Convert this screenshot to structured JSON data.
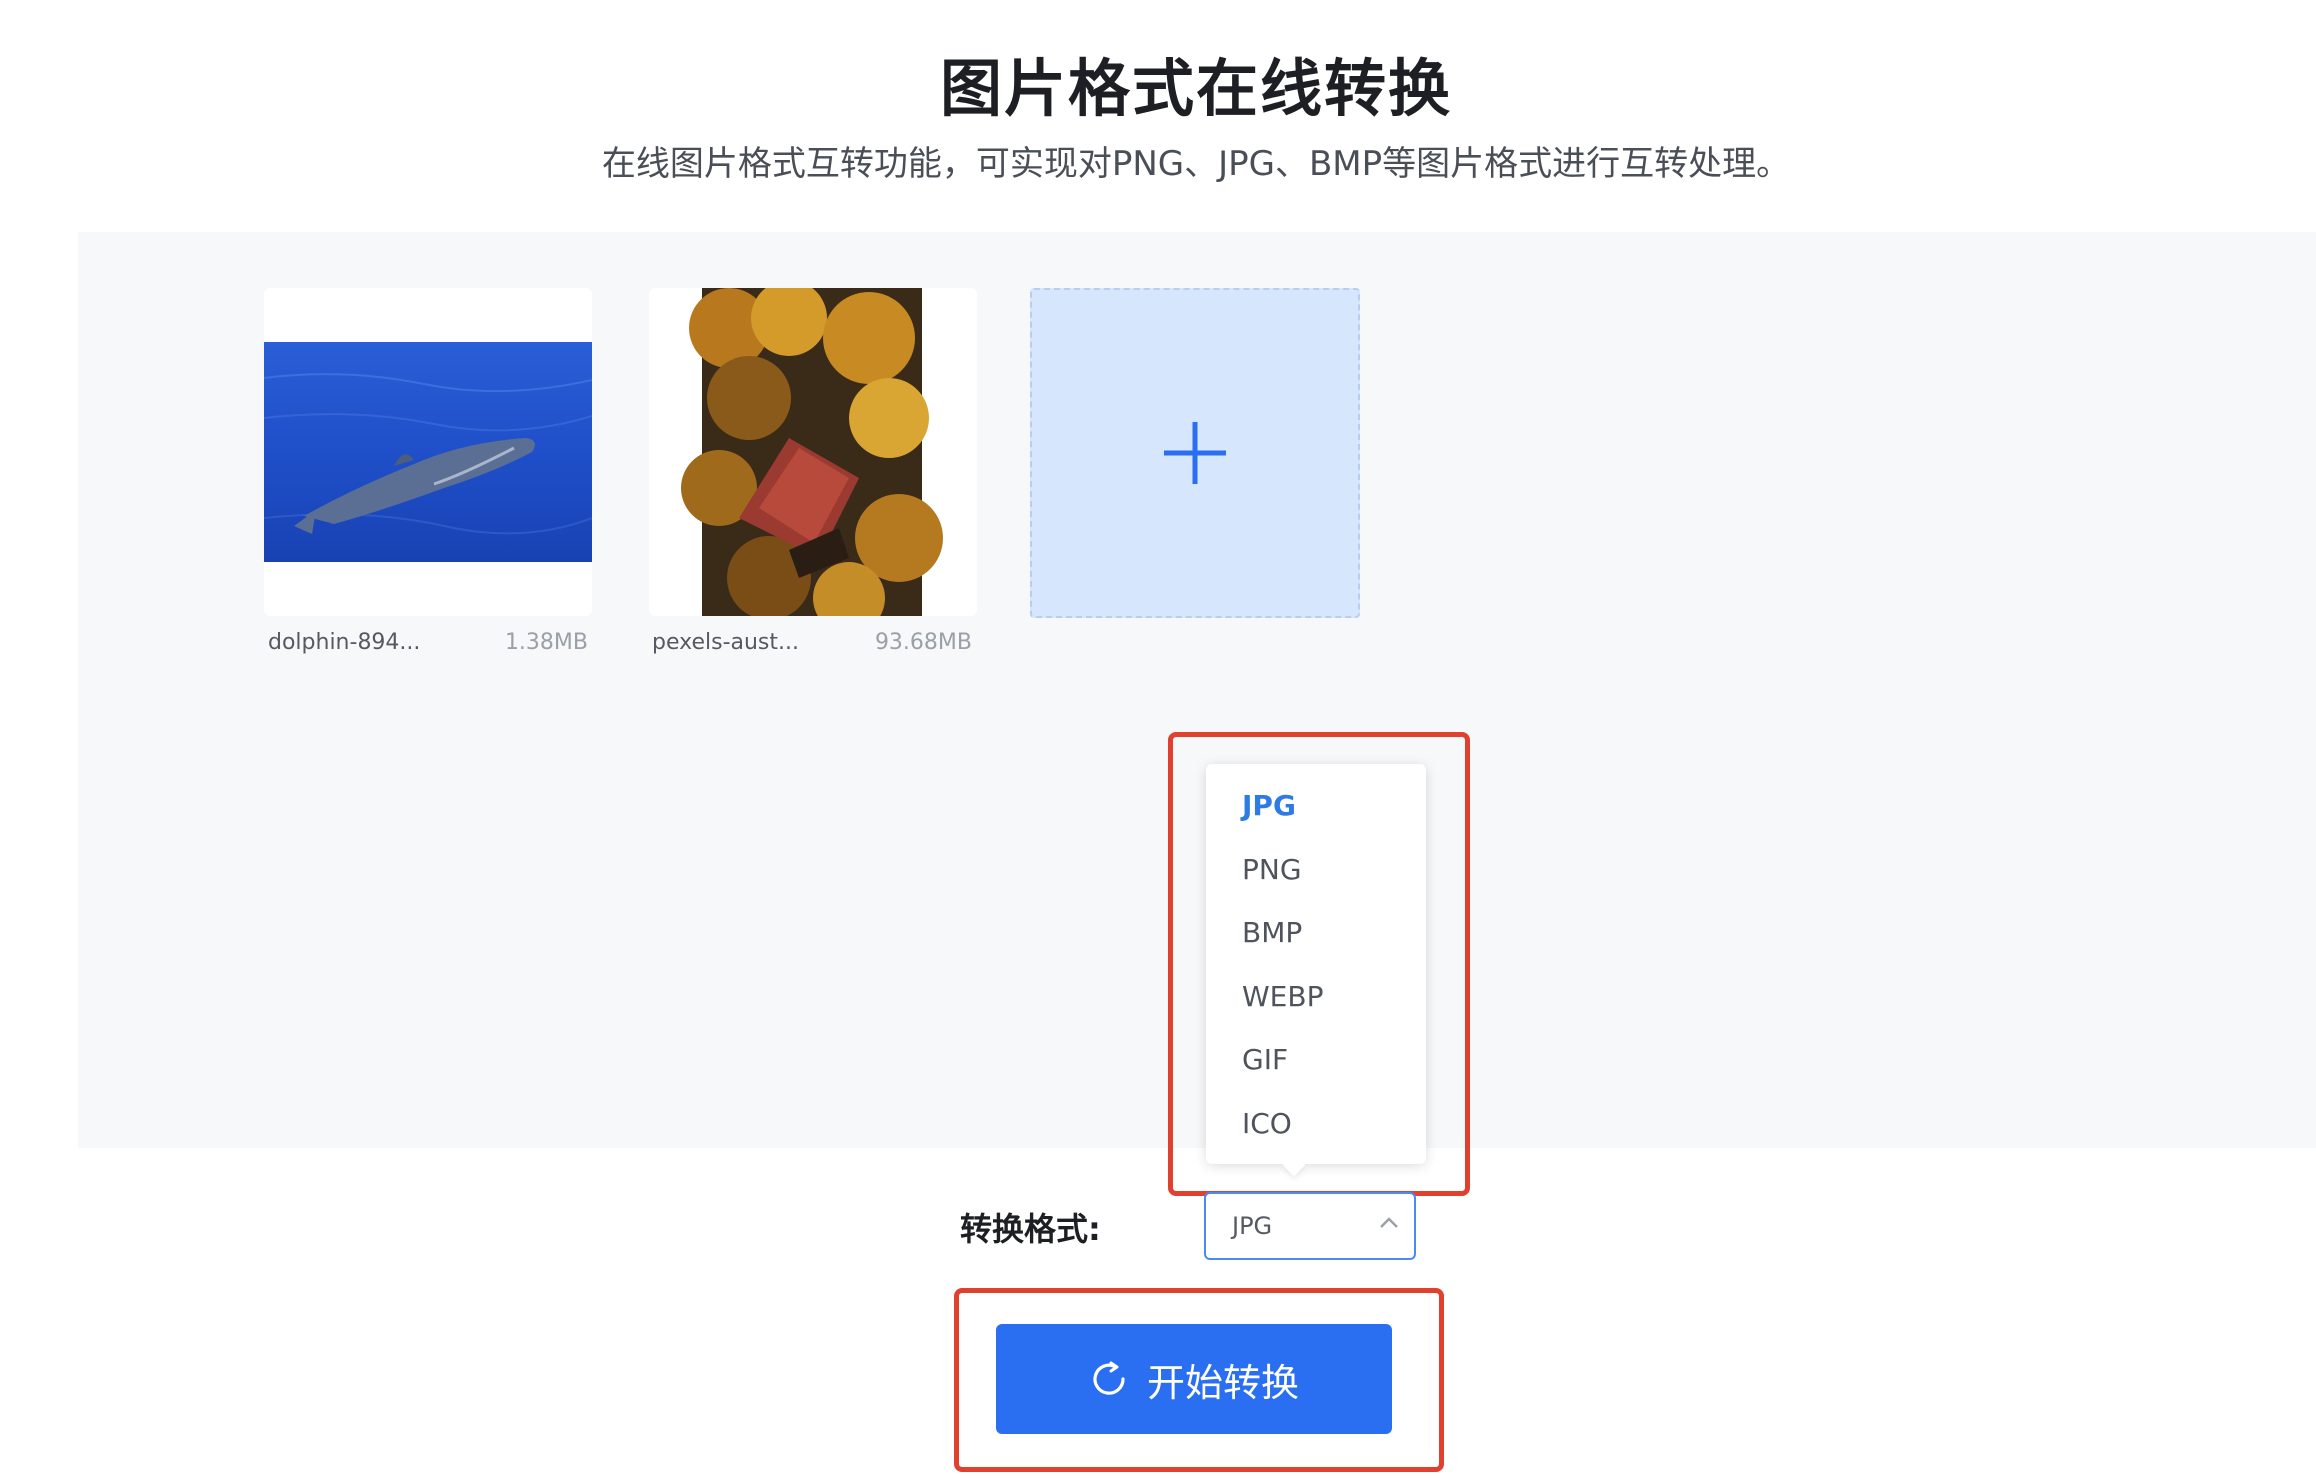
{
  "page": {
    "title": "图片格式在线转换",
    "subtitle": "在线图片格式互转功能，可实现对PNG、JPG、BMP等图片格式进行互转处理。"
  },
  "files": [
    {
      "name": "dolphin-894...",
      "size": "1.38MB"
    },
    {
      "name": "pexels-aust...",
      "size": "93.68MB"
    }
  ],
  "dropdown": {
    "options": [
      "JPG",
      "PNG",
      "BMP",
      "WEBP",
      "GIF",
      "ICO"
    ],
    "selected_index": 0
  },
  "format": {
    "label": "转换格式:",
    "value": "JPG"
  },
  "start_button": {
    "label": "开始转换"
  },
  "colors": {
    "accent": "#2a6ff2",
    "highlight": "#e2402f",
    "selected_option": "#2f7be6"
  }
}
